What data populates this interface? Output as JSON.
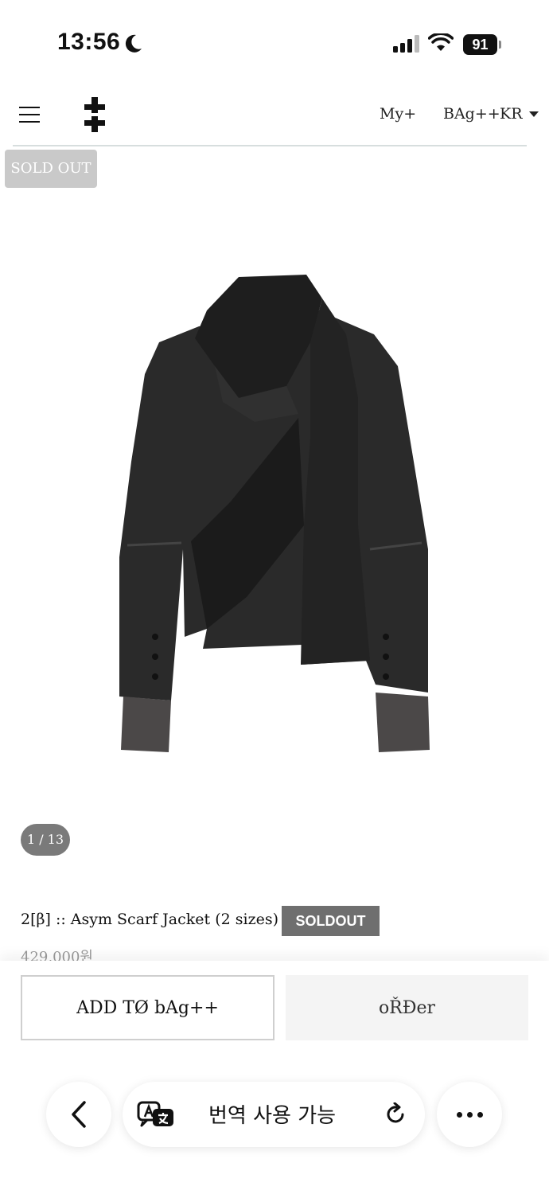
{
  "status_bar": {
    "time": "13:56",
    "battery": "91"
  },
  "header": {
    "my_label": "My+",
    "bag_label": "BAg++",
    "lang_label": "KR"
  },
  "badge": {
    "sold_out": "SOLD OUT"
  },
  "gallery": {
    "pager": "1 / 13"
  },
  "product": {
    "title": "2[β] :: Asym Scarf Jacket (2 sizes)",
    "status_tag": "SOLDOUT",
    "price": "429,000원"
  },
  "actions": {
    "add_to_bag": "ADD TØ bAg++",
    "order": "oŘĐer"
  },
  "browser": {
    "translate_label": "번역 사용 가능"
  },
  "icons": {
    "menu": "hamburger-icon",
    "logo": "double-cross-logo-icon",
    "back": "chevron-left-icon",
    "translate": "translate-icon",
    "reload": "reload-icon",
    "more": "more-dots-icon"
  }
}
